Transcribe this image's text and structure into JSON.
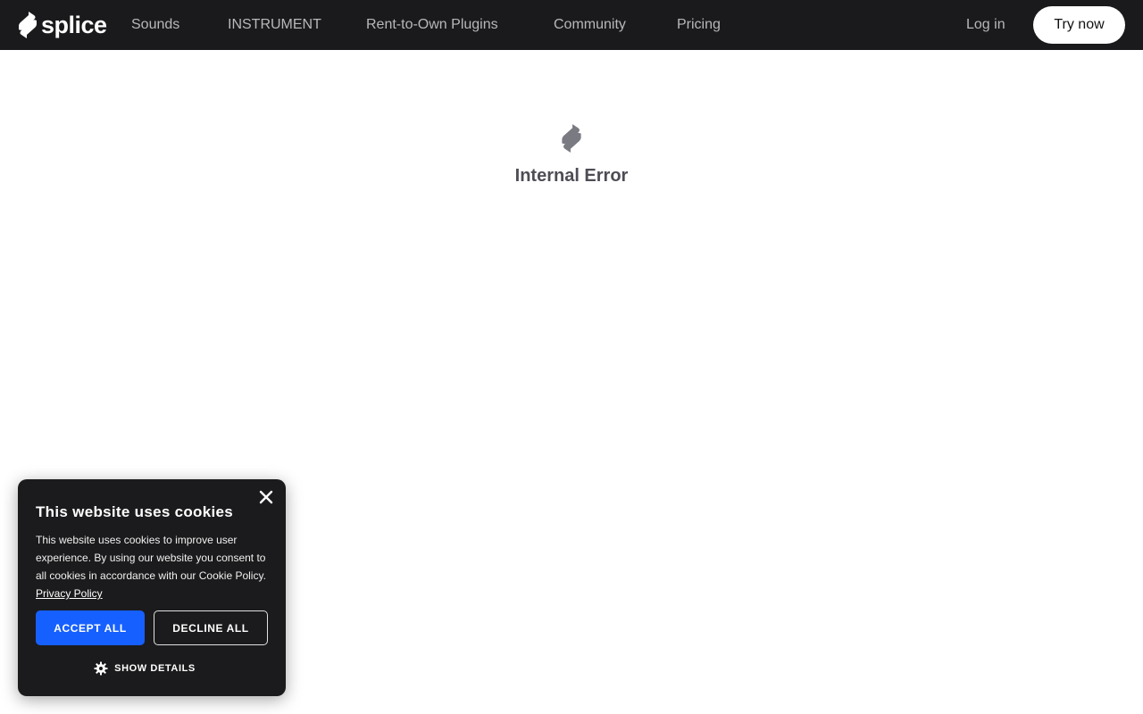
{
  "brand": {
    "name": "splice"
  },
  "nav": {
    "items": [
      {
        "label": "Sounds"
      },
      {
        "label": "INSTRUMENT"
      },
      {
        "label": "Rent-to-Own Plugins"
      },
      {
        "label": "Community"
      },
      {
        "label": "Pricing"
      }
    ],
    "login_label": "Log in",
    "cta_label": "Try now"
  },
  "error": {
    "title": "Internal Error",
    "icon": "splice-logo-icon"
  },
  "cookie_banner": {
    "title": "This website uses cookies",
    "body": "This website uses cookies to improve user experience. By using our website you consent to all cookies in accordance with our Cookie Policy.",
    "link_label": "Privacy Policy",
    "accept_label": "ACCEPT ALL",
    "decline_label": "DECLINE ALL",
    "details_label": "SHOW DETAILS",
    "details_icon": "gear-icon",
    "close_icon": "close-icon"
  },
  "colors": {
    "topbar_bg": "#1a1a1c",
    "accent": "#1660ff",
    "nav_text": "#b8b8bc",
    "error_text": "#4d4d55"
  }
}
